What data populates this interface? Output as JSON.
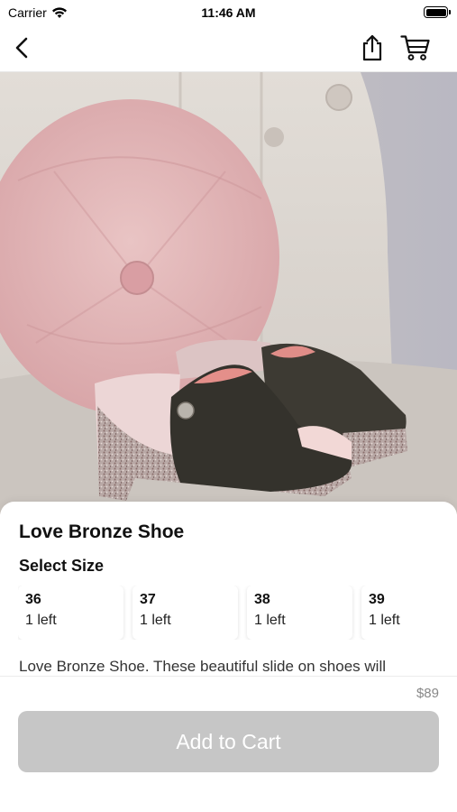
{
  "status_bar": {
    "carrier": "Carrier",
    "time": "11:46 AM"
  },
  "nav": {
    "back_icon": "chevron-left-icon",
    "share_icon": "share-icon",
    "cart_icon": "cart-icon"
  },
  "product": {
    "title": "Love Bronze Shoe",
    "size_heading": "Select Size",
    "sizes": [
      {
        "size": "36",
        "stock": "1 left"
      },
      {
        "size": "37",
        "stock": "1 left"
      },
      {
        "size": "38",
        "stock": "1 left"
      },
      {
        "size": "39",
        "stock": "1 left"
      }
    ],
    "description": "Love Bronze Shoe. These beautiful slide on shoes will",
    "price": "$89"
  },
  "actions": {
    "add_to_cart_label": "Add to Cart"
  },
  "colors": {
    "button_disabled": "#c6c6c6",
    "price_text": "#888888"
  }
}
